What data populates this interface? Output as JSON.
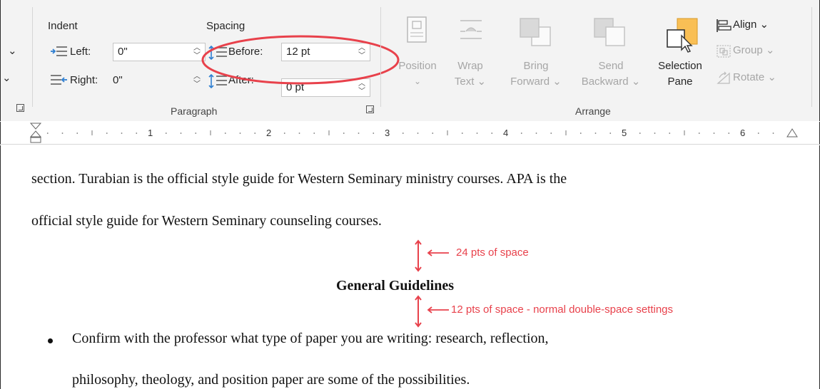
{
  "ribbon": {
    "indent": {
      "title": "Indent",
      "left_label": "Left:",
      "left_value": "0\"",
      "right_label": "Right:",
      "right_value": "0\""
    },
    "spacing": {
      "title": "Spacing",
      "before_label": "Before:",
      "before_value": "12 pt",
      "after_label": "After:",
      "after_value": "0 pt"
    },
    "paragraph_group_label": "Paragraph",
    "arrange": {
      "position": {
        "line1": "Position",
        "line2": "⌄"
      },
      "wrap_text": {
        "line1": "Wrap",
        "line2": "Text ⌄"
      },
      "bring_forward": {
        "line1": "Bring",
        "line2": "Forward ⌄"
      },
      "send_backward": {
        "line1": "Send",
        "line2": "Backward ⌄"
      },
      "selection_pane": {
        "line1": "Selection",
        "line2": "Pane"
      },
      "align": "Align ⌄",
      "group": "Group ⌄",
      "rotate": "Rotate ⌄",
      "group_label": "Arrange"
    },
    "left_chevron_top": "⌄",
    "left_chevron_bottom": "⌄"
  },
  "ruler": {
    "numbers": [
      "1",
      "2",
      "3",
      "4",
      "5",
      "6"
    ]
  },
  "document": {
    "line1": "section. Turabian is the official style guide for Western Seminary ministry courses. APA is the",
    "line2": "official style guide for Western Seminary counseling courses.",
    "heading": "General Guidelines",
    "bullet_line1": "Confirm with the professor what type of paper you are writing: research, reflection,",
    "bullet_line2": "philosophy, theology, and position paper are some of the possibilities."
  },
  "annotations": {
    "note1": "24 pts of space",
    "note2": "12 pts of space - normal double-space settings",
    "color": "#e8414b"
  }
}
